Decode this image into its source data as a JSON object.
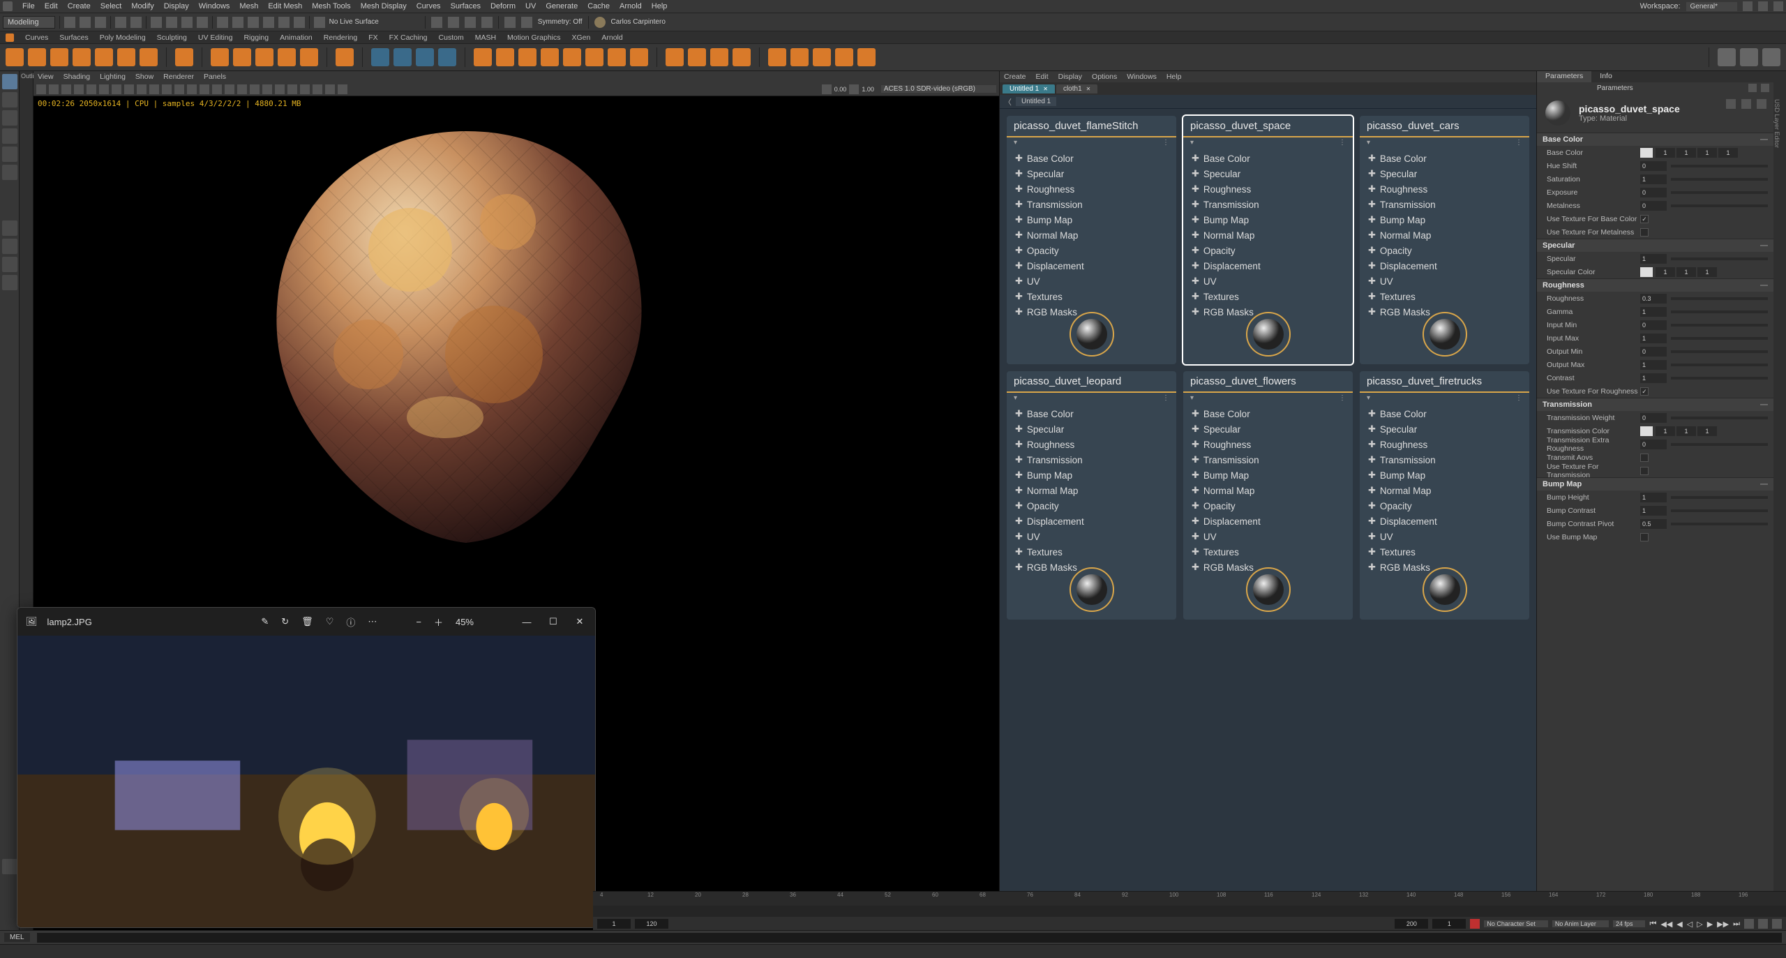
{
  "menubar": [
    "File",
    "Edit",
    "Create",
    "Select",
    "Modify",
    "Display",
    "Windows",
    "Mesh",
    "Edit Mesh",
    "Mesh Tools",
    "Mesh Display",
    "Curves",
    "Surfaces",
    "Deform",
    "UV",
    "Generate",
    "Cache",
    "Arnold",
    "Help"
  ],
  "workspace_label": "Workspace:",
  "workspace_value": "General*",
  "toolbar2": {
    "mode": "Modeling",
    "noLiveSurface": "No Live Surface",
    "symmetry": "Symmetry: Off",
    "user": "Carlos Carpintero"
  },
  "shelftabs": [
    "Curves",
    "Surfaces",
    "Poly Modeling",
    "Sculpting",
    "UV Editing",
    "Rigging",
    "Animation",
    "Rendering",
    "FX",
    "FX Caching",
    "Custom",
    "MASH",
    "Motion Graphics",
    "XGen",
    "Arnold"
  ],
  "outliner_label": "Outliner",
  "right_strip_label": "USD Layer Editor",
  "viewport_menus": [
    "View",
    "Shading",
    "Lighting",
    "Show",
    "Renderer",
    "Panels"
  ],
  "viewport_colorspace": "ACES 1.0 SDR-video (sRGB)",
  "viewport_gamma": "1.00",
  "viewport_exposure": "0.00",
  "render_stats": "00:02:26  2050x1614 | CPU | samples 4/3/2/2/2 | 4880.21 MB",
  "float_window": {
    "title": "lamp2.JPG",
    "zoom": "45%"
  },
  "lookdev_menus": [
    "Create",
    "Edit",
    "Display",
    "Options",
    "Windows",
    "Help"
  ],
  "lookdev_tabs": [
    {
      "label": "Untitled 1",
      "active": true
    },
    {
      "label": "cloth1",
      "active": false
    }
  ],
  "lookdev_breadcrumb": "Untitled 1",
  "material_channels": [
    "Base Color",
    "Specular",
    "Roughness",
    "Transmission",
    "Bump Map",
    "Normal Map",
    "Opacity",
    "Displacement",
    "UV",
    "Textures",
    "RGB Masks"
  ],
  "materials": [
    {
      "name": "picasso_duvet_flameStitch",
      "selected": false
    },
    {
      "name": "picasso_duvet_space",
      "selected": true
    },
    {
      "name": "picasso_duvet_cars",
      "selected": false
    },
    {
      "name": "picasso_duvet_leopard",
      "selected": false
    },
    {
      "name": "picasso_duvet_flowers",
      "selected": false
    },
    {
      "name": "picasso_duvet_firetrucks",
      "selected": false
    }
  ],
  "params_tabs": [
    "Parameters",
    "Info"
  ],
  "params_sub_label": "Parameters",
  "params_header": {
    "name": "picasso_duvet_space",
    "type": "Type: Material"
  },
  "params_sections": {
    "baseColor": {
      "title": "Base Color",
      "rows": {
        "baseColor": {
          "label": "Base  Color",
          "swatch": "#dedede",
          "vals": [
            "1",
            "1",
            "1",
            "1"
          ]
        },
        "hueShift": {
          "label": "Hue Shift",
          "num": "0"
        },
        "saturation": {
          "label": "Saturation",
          "num": "1"
        },
        "exposure": {
          "label": "Exposure",
          "num": "0"
        },
        "metalness": {
          "label": "Metalness",
          "num": "0"
        },
        "useTexBC": {
          "label": "Use Texture For  Base  Color",
          "checked": true
        },
        "useTexMet": {
          "label": "Use Texture For  Metalness",
          "checked": false
        }
      }
    },
    "specular": {
      "title": "Specular",
      "rows": {
        "specular": {
          "label": "Specular",
          "num": "1"
        },
        "specularColor": {
          "label": "Specular Color",
          "swatch": "#dedede",
          "vals": [
            "1",
            "1",
            "1"
          ]
        }
      }
    },
    "roughness": {
      "title": "Roughness",
      "rows": {
        "roughness": {
          "label": "Roughness",
          "num": "0.3"
        },
        "gamma": {
          "label": "Gamma",
          "num": "1"
        },
        "inputMin": {
          "label": "Input Min",
          "num": "0"
        },
        "inputMax": {
          "label": "Input Max",
          "num": "1"
        },
        "outputMin": {
          "label": "Output Min",
          "num": "0"
        },
        "outputMax": {
          "label": "Output Max",
          "num": "1"
        },
        "contrast": {
          "label": "Contrast",
          "num": "1"
        },
        "useTexR": {
          "label": "Use Texture For  Roughness",
          "checked": true
        }
      }
    },
    "transmission": {
      "title": "Transmission",
      "rows": {
        "weight": {
          "label": "Transmission  Weight",
          "num": "0"
        },
        "color": {
          "label": "Transmission Color",
          "swatch": "#dedede",
          "vals": [
            "1",
            "1",
            "1"
          ]
        },
        "extraR": {
          "label": "Transmission Extra Roughness",
          "num": "0"
        },
        "aovs": {
          "label": "Transmit Aovs",
          "checked": false
        },
        "useTexT": {
          "label": "Use Texture For  Transmission",
          "checked": false
        }
      }
    },
    "bumpMap": {
      "title": "Bump Map",
      "rows": {
        "height": {
          "label": "Bump Height",
          "num": "1"
        },
        "contrast": {
          "label": "Bump  Contrast",
          "num": "1"
        },
        "contrastPivot": {
          "label": "Bump  Contrast  Pivot",
          "num": "0.5"
        },
        "useBump": {
          "label": "Use  Bump Map",
          "checked": false
        }
      }
    }
  },
  "timeline": {
    "ticks": [
      "4",
      "12",
      "20",
      "28",
      "36",
      "44",
      "52",
      "60",
      "68",
      "76",
      "84",
      "92",
      "100",
      "108",
      "116",
      "124",
      "132",
      "140",
      "148",
      "156",
      "164",
      "172",
      "180",
      "188",
      "196"
    ],
    "range_start": "1",
    "range_end": "200",
    "display_start": "1",
    "display_end": "120",
    "frame": "1",
    "charset": "No Character Set",
    "animlayer": "No Anim Layer",
    "fps": "24 fps"
  },
  "cmdline_lang": "MEL"
}
